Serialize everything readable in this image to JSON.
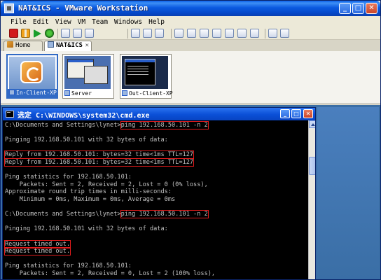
{
  "window": {
    "title": "NAT&ICS - VMware Workstation"
  },
  "menu": [
    "File",
    "Edit",
    "View",
    "VM",
    "Team",
    "Windows",
    "Help"
  ],
  "tabs": [
    {
      "label": "Home"
    },
    {
      "label": "NAT&ICS"
    }
  ],
  "thumbnails": [
    {
      "label": "In-Client-XP"
    },
    {
      "label": "Server"
    },
    {
      "label": "Out-Client-XP"
    }
  ],
  "cmd": {
    "title": "选定 C:\\WINDOWS\\system32\\cmd.exe",
    "lines": [
      {
        "pre": "C:\\Documents and Settings\\lynet>",
        "hl": "ping 192.168.50.101 -n 2"
      },
      {
        "pre": ""
      },
      {
        "pre": "Pinging 192.168.50.101 with 32 bytes of data:"
      },
      {
        "pre": ""
      },
      {
        "pre": "",
        "hl": "Reply from 192.168.50.101: bytes=32 time<1ms TTL=127"
      },
      {
        "pre": "",
        "hl": "Reply from 192.168.50.101: bytes=32 time<1ms TTL=127"
      },
      {
        "pre": ""
      },
      {
        "pre": "Ping statistics for 192.168.50.101:"
      },
      {
        "pre": "    Packets: Sent = 2, Received = 2, Lost = 0 (0% loss),"
      },
      {
        "pre": "Approximate round trip times in milli-seconds:"
      },
      {
        "pre": "    Minimum = 0ms, Maximum = 0ms, Average = 0ms"
      },
      {
        "pre": ""
      },
      {
        "pre": "C:\\Documents and Settings\\lynet>",
        "hl": "ping 192.168.50.101 -n 2"
      },
      {
        "pre": ""
      },
      {
        "pre": "Pinging 192.168.50.101 with 32 bytes of data:"
      },
      {
        "pre": ""
      },
      {
        "pre": "",
        "hl": "Request timed out."
      },
      {
        "pre": "",
        "hl": "Request timed out."
      },
      {
        "pre": ""
      },
      {
        "pre": "Ping statistics for 192.168.50.101:"
      },
      {
        "pre": "    Packets: Sent = 2, Received = 0, Lost = 2 (100% loss),"
      }
    ]
  }
}
